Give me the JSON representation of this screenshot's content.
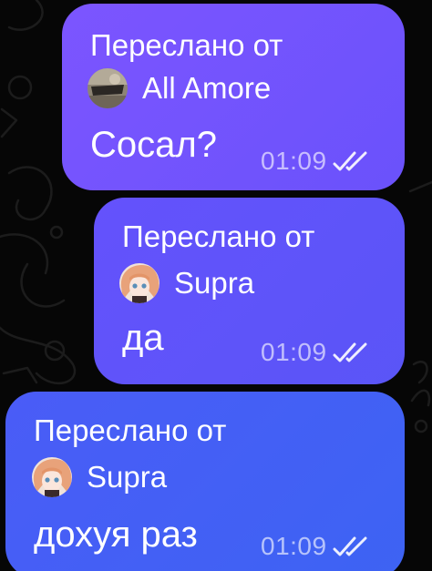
{
  "messages": [
    {
      "forwarded_label": "Переслано от",
      "sender": "All Amore",
      "avatar_icon": "user-photo-avatar",
      "text": "Сосал?",
      "time": "01:09",
      "status_icon": "double-check-icon"
    },
    {
      "forwarded_label": "Переслано от",
      "sender": "Supra",
      "avatar_icon": "anime-girl-avatar",
      "text": "да",
      "time": "01:09",
      "status_icon": "double-check-icon"
    },
    {
      "forwarded_label": "Переслано от",
      "sender": "Supra",
      "avatar_icon": "anime-girl-avatar",
      "text": "дохуя раз",
      "time": "01:09",
      "status_icon": "double-check-icon"
    }
  ],
  "colors": {
    "background": "#060606",
    "bubble_1": "#7255fe",
    "bubble_2": "#5f54fa",
    "bubble_3": "#4360f5",
    "text": "#ffffff",
    "meta": "#c8c8ff"
  }
}
